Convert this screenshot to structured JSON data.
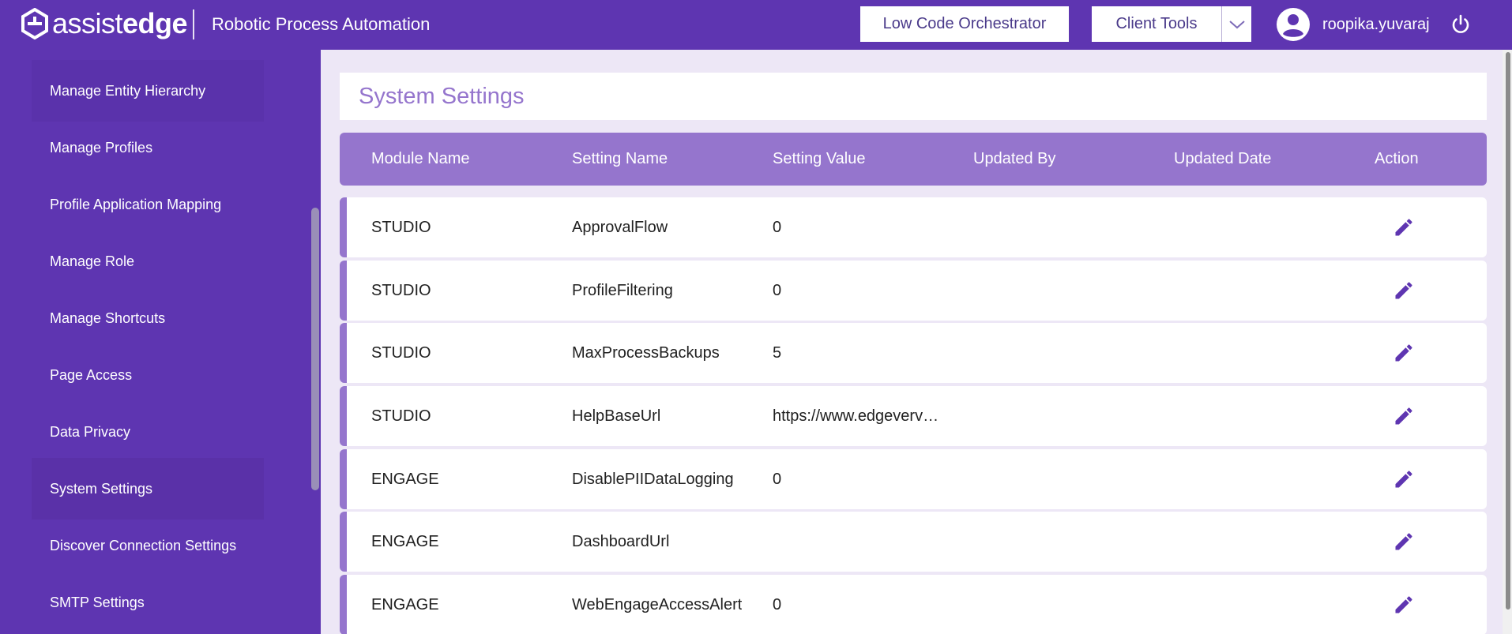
{
  "header": {
    "logo_light": "assist",
    "logo_bold": "edge",
    "app_title": "Robotic Process Automation",
    "orchestrator_label": "Low Code Orchestrator",
    "client_tools_label": "Client Tools",
    "username": "roopika.yuvaraj"
  },
  "sidebar": {
    "items": [
      {
        "label": "Manage Entity Hierarchy"
      },
      {
        "label": "Manage Profiles"
      },
      {
        "label": "Profile Application Mapping"
      },
      {
        "label": "Manage Role"
      },
      {
        "label": "Manage Shortcuts"
      },
      {
        "label": "Page Access"
      },
      {
        "label": "Data Privacy"
      },
      {
        "label": "System Settings"
      },
      {
        "label": "Discover Connection Settings"
      },
      {
        "label": "SMTP Settings"
      }
    ],
    "active": "System Settings"
  },
  "main": {
    "title": "System Settings",
    "columns": [
      "Module Name",
      "Setting Name",
      "Setting Value",
      "Updated By",
      "Updated Date",
      "Action"
    ],
    "rows": [
      {
        "module": "STUDIO",
        "setting": "ApprovalFlow",
        "value": "0",
        "updated_by": "",
        "updated_date": ""
      },
      {
        "module": "STUDIO",
        "setting": "ProfileFiltering",
        "value": "0",
        "updated_by": "",
        "updated_date": ""
      },
      {
        "module": "STUDIO",
        "setting": "MaxProcessBackups",
        "value": "5",
        "updated_by": "",
        "updated_date": ""
      },
      {
        "module": "STUDIO",
        "setting": "HelpBaseUrl",
        "value": "https://www.edgeverv…",
        "updated_by": "",
        "updated_date": ""
      },
      {
        "module": "ENGAGE",
        "setting": "DisablePIIDataLogging",
        "value": "0",
        "updated_by": "",
        "updated_date": ""
      },
      {
        "module": "ENGAGE",
        "setting": "DashboardUrl",
        "value": "",
        "updated_by": "",
        "updated_date": ""
      },
      {
        "module": "ENGAGE",
        "setting": "WebEngageAccessAlert",
        "value": "0",
        "updated_by": "",
        "updated_date": ""
      }
    ]
  },
  "colors": {
    "brand_purple": "#5e35b1",
    "header_row": "#9575cd",
    "content_bg": "#ede7f6",
    "edit_icon": "#5e35b1"
  },
  "icons": {
    "row_action": "pencil-edit-icon",
    "user": "account-circle-icon",
    "logout": "power-icon",
    "dropdown": "chevron-down-icon"
  }
}
